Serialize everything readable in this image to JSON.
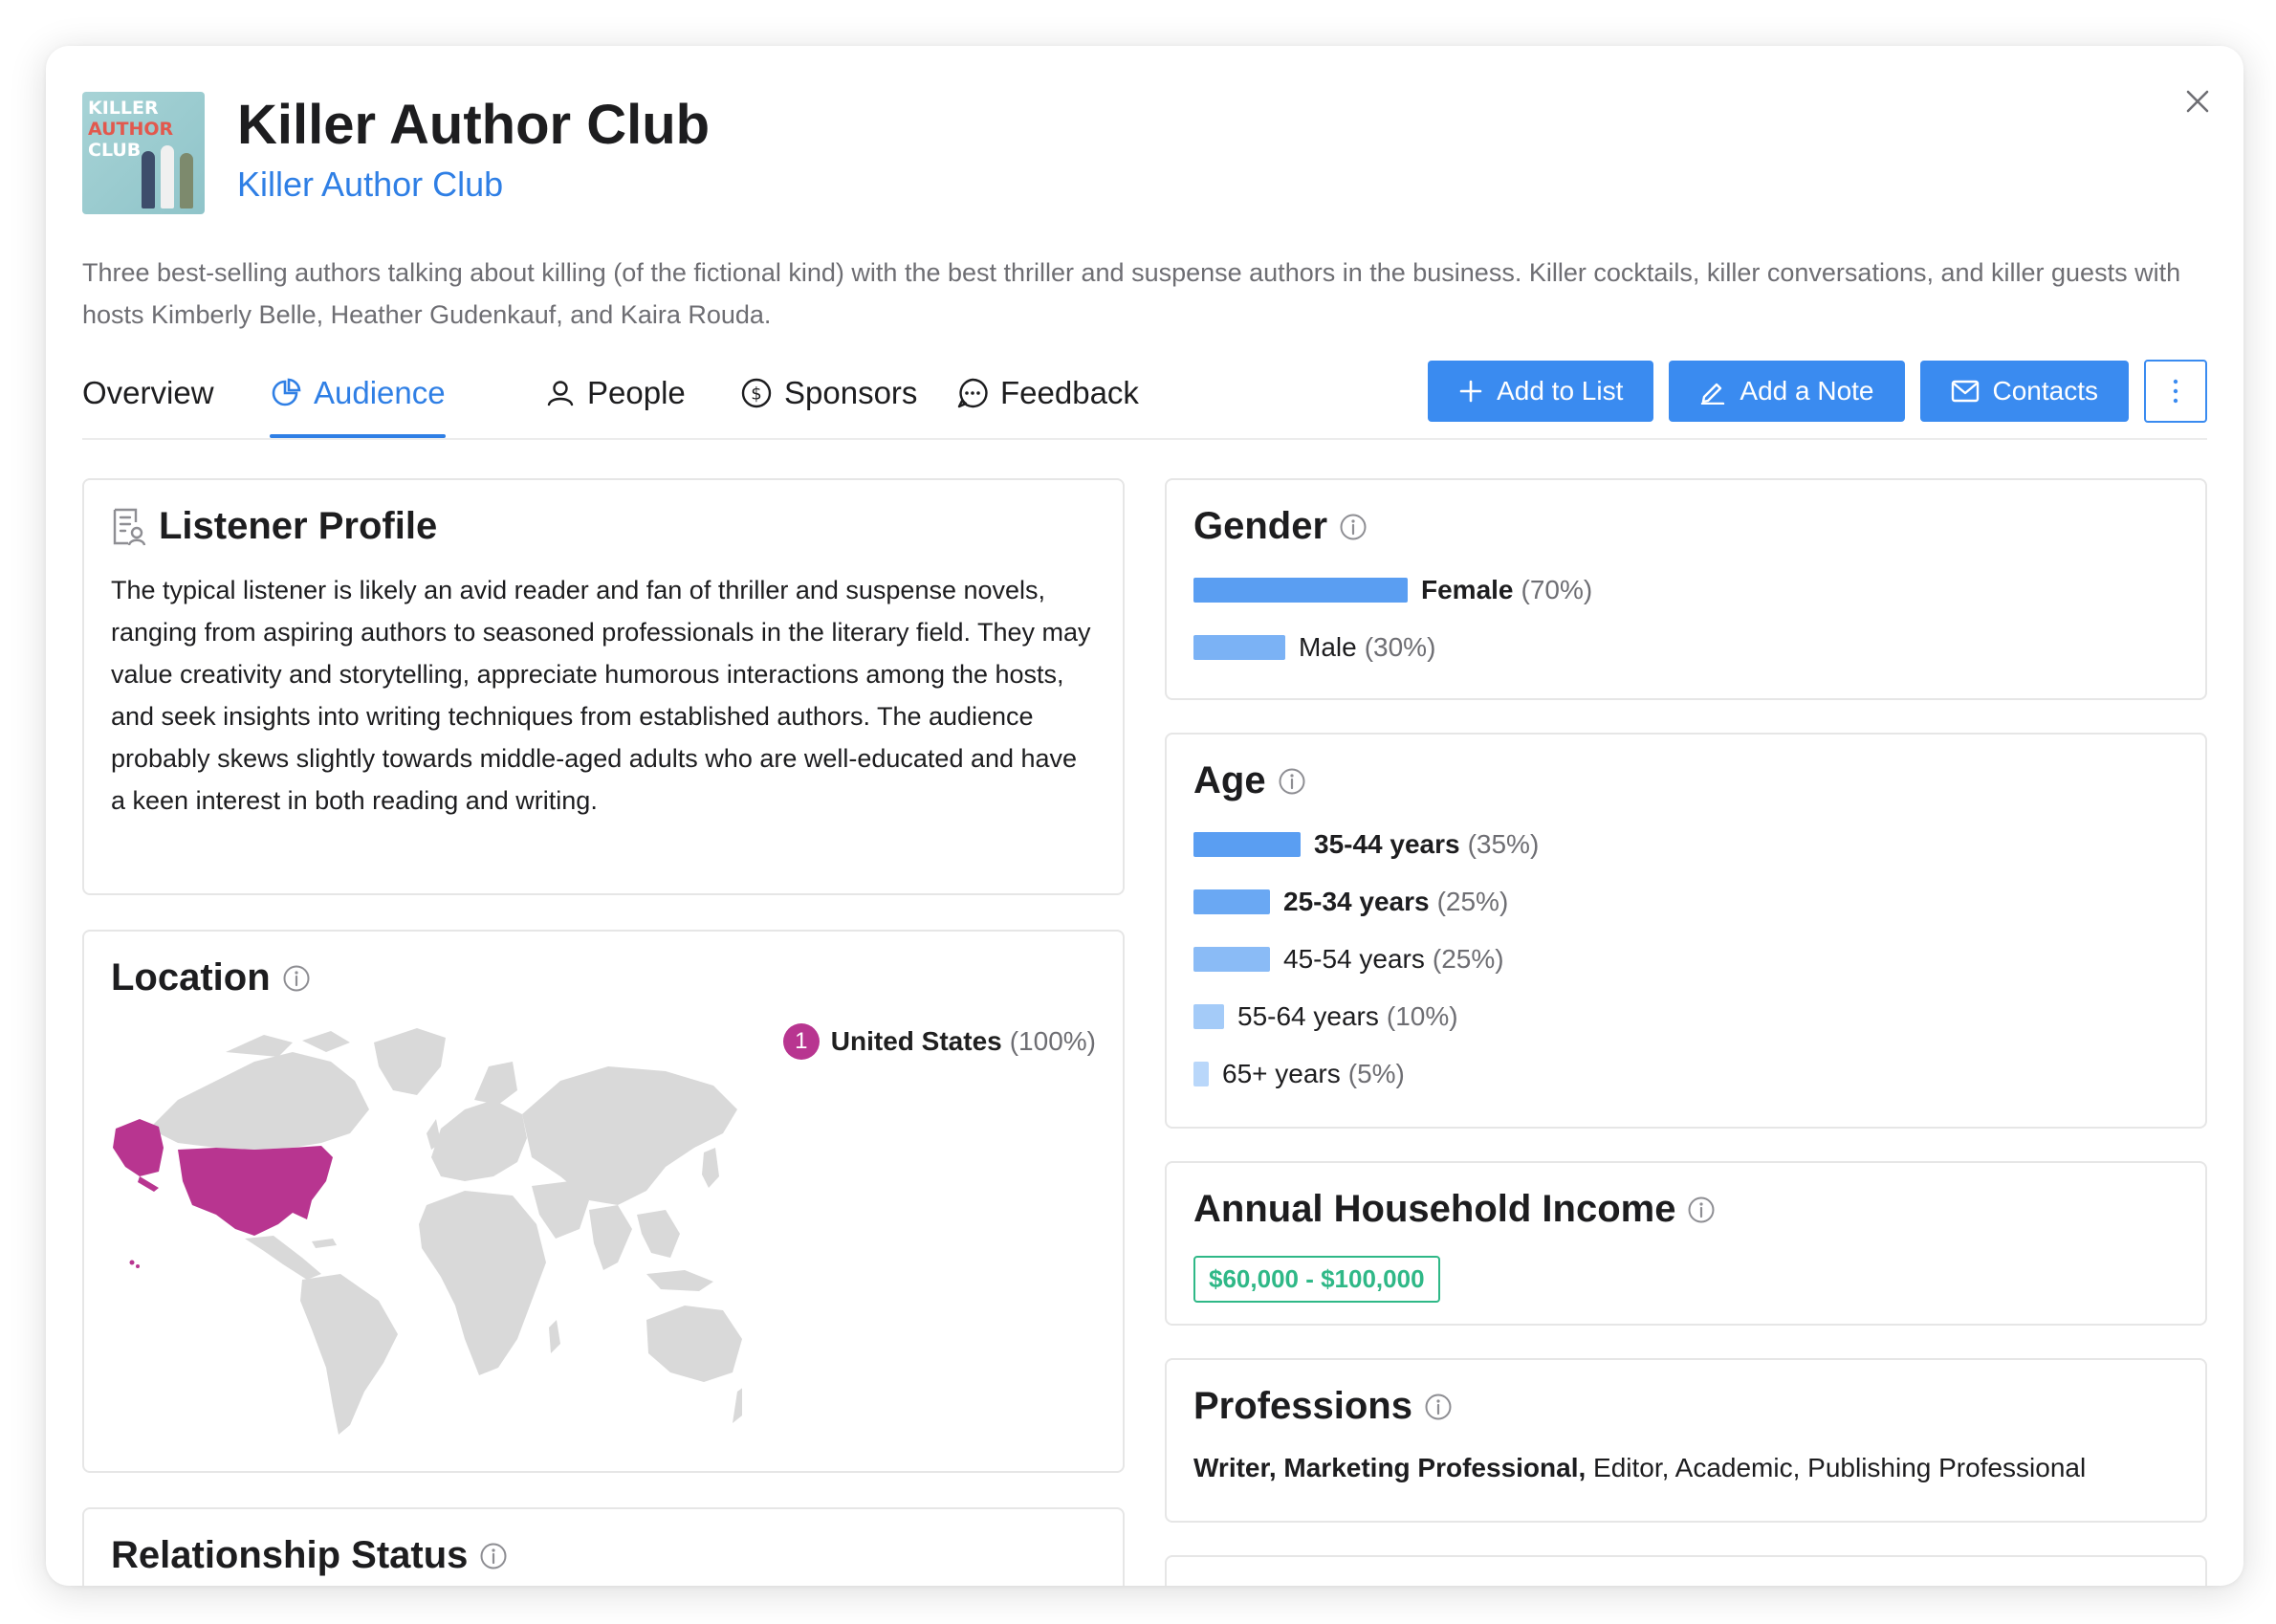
{
  "header": {
    "title": "Killer Author Club",
    "subtitle": "Killer Author Club",
    "description": "Three best-selling authors talking about killing (of the fictional kind) with the best thriller and suspense authors in the business. Killer cocktails, killer conversations, and killer guests with hosts Kimberly Belle, Heather Gudenkauf, and Kaira Rouda.",
    "cover": {
      "line1": "KILLER",
      "line2": "AUTHOR",
      "line3": "CLUB"
    }
  },
  "tabs": [
    {
      "label": "Overview",
      "icon": "none",
      "active": false
    },
    {
      "label": "Audience",
      "icon": "pie-chart-icon",
      "active": true
    },
    {
      "label": "People",
      "icon": "person-icon",
      "active": false
    },
    {
      "label": "Sponsors",
      "icon": "dollar-icon",
      "active": false
    },
    {
      "label": "Feedback",
      "icon": "chat-bubble-icon",
      "active": false
    }
  ],
  "actions": {
    "add_to_list": "Add to List",
    "add_note": "Add a Note",
    "contacts": "Contacts"
  },
  "listener_profile": {
    "title": "Listener Profile",
    "text": "The typical listener is likely an avid reader and fan of thriller and suspense novels, ranging from aspiring authors to seasoned professionals in the literary field. They may value creativity and storytelling, appreciate humorous interactions among the hosts, and seek insights into writing techniques from established authors. The audience probably skews slightly towards middle-aged adults who are well-educated and have a keen interest in both reading and writing."
  },
  "location": {
    "title": "Location",
    "items": [
      {
        "rank": "1",
        "country": "United States",
        "pct": "(100%)"
      }
    ]
  },
  "relationship": {
    "title": "Relationship Status"
  },
  "gender": {
    "title": "Gender",
    "items": [
      {
        "label": "Female",
        "pct": "(70%)",
        "value": 70,
        "bold": true
      },
      {
        "label": "Male",
        "pct": "(30%)",
        "value": 30,
        "bold": false
      }
    ]
  },
  "age": {
    "title": "Age",
    "items": [
      {
        "label": "35-44 years",
        "pct": "(35%)",
        "value": 35,
        "bold": true
      },
      {
        "label": "25-34 years",
        "pct": "(25%)",
        "value": 25,
        "bold": true
      },
      {
        "label": "45-54 years",
        "pct": "(25%)",
        "value": 25,
        "bold": false
      },
      {
        "label": "55-64 years",
        "pct": "(10%)",
        "value": 10,
        "bold": false
      },
      {
        "label": "65+ years",
        "pct": "(5%)",
        "value": 5,
        "bold": false
      }
    ]
  },
  "income": {
    "title": "Annual Household Income",
    "value": "$60,000 - $100,000"
  },
  "professions": {
    "title": "Professions",
    "bold_part": "Writer, Marketing Professional,",
    "rest": " Editor, Academic, Publishing Professional"
  },
  "colors": {
    "accent": "#3a8bf0",
    "link": "#2f7fe5",
    "map_highlight": "#b83590",
    "map_base": "#d9d9d9",
    "income": "#2fb887"
  }
}
